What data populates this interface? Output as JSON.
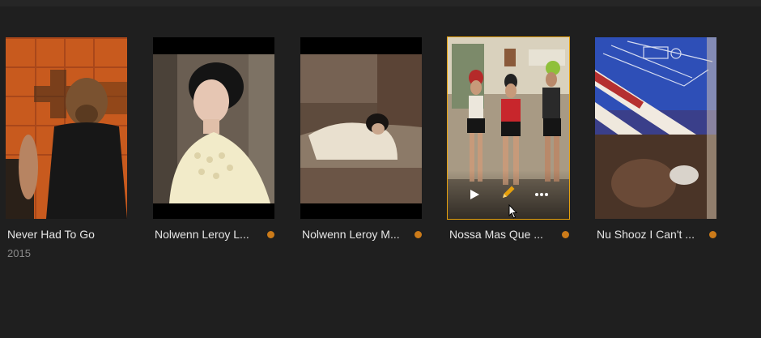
{
  "library": {
    "items": [
      {
        "title": "Never Had To Go",
        "year": "2015",
        "unwatched": false
      },
      {
        "title": "Nolwenn Leroy L...",
        "unwatched": true
      },
      {
        "title": "Nolwenn Leroy M...",
        "unwatched": true
      },
      {
        "title": "Nossa Mas Que ...",
        "unwatched": true,
        "selected": true
      },
      {
        "title": "Nu Shooz I Can't ...",
        "unwatched": true
      }
    ]
  },
  "colors": {
    "background": "#1f1f1f",
    "accent": "#e5a00d",
    "unwatched_dot": "#cc7b19"
  },
  "icons": {
    "play": "play-icon",
    "edit": "pencil-icon",
    "more": "more-icon"
  }
}
